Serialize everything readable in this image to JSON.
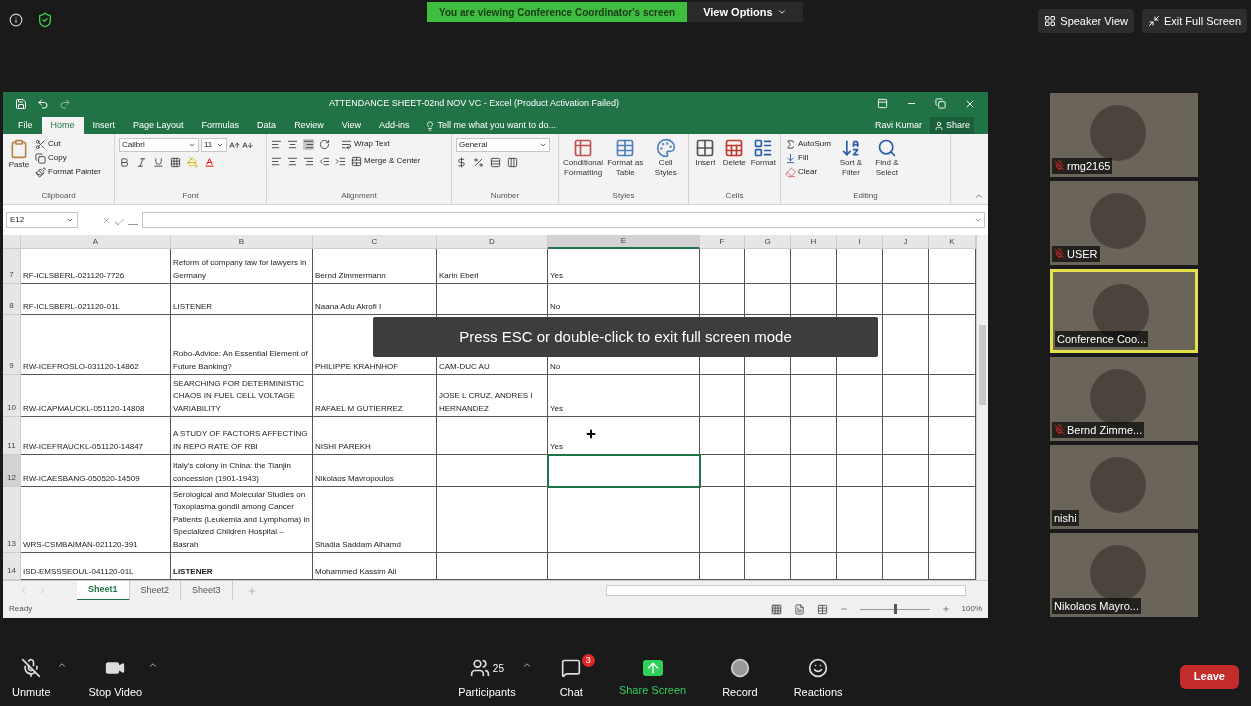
{
  "top_bar": {
    "banner": "You are viewing Conference Coordinator's screen",
    "view_options": "View Options",
    "speaker_view": "Speaker View",
    "exit_full_screen": "Exit Full Screen"
  },
  "excel": {
    "title": "ATTENDANCE SHEET-02nd NOV VC - Excel (Product Activation Failed)",
    "tabs": [
      {
        "label": "File",
        "selected": false
      },
      {
        "label": "Home",
        "selected": true
      },
      {
        "label": "Insert",
        "selected": false
      },
      {
        "label": "Page Layout",
        "selected": false
      },
      {
        "label": "Formulas",
        "selected": false
      },
      {
        "label": "Data",
        "selected": false
      },
      {
        "label": "Review",
        "selected": false
      },
      {
        "label": "View",
        "selected": false
      },
      {
        "label": "Add-ins",
        "selected": false
      }
    ],
    "tell_me": "Tell me what you want to do...",
    "user": "Ravi Kumar",
    "share": "Share",
    "ribbon": {
      "clipboard": {
        "label": "Clipboard",
        "paste": "Paste",
        "cut": "Cut",
        "copy": "Copy",
        "format_painter": "Format Painter"
      },
      "font": {
        "label": "Font",
        "name": "Calibri",
        "size": "11"
      },
      "alignment": {
        "label": "Alignment",
        "wrap_text": "Wrap Text",
        "merge_center": "Merge & Center"
      },
      "number": {
        "label": "Number",
        "format": "General"
      },
      "styles": {
        "label": "Styles",
        "items": [
          "Conditional Formatting",
          "Format as Table",
          "Cell Styles"
        ]
      },
      "cells": {
        "label": "Cells",
        "items": [
          "Insert",
          "Delete",
          "Format"
        ]
      },
      "editing": {
        "label": "Editing",
        "autosum": "AutoSum",
        "fill": "Fill",
        "clear": "Clear",
        "sort_filter": "Sort & Filter",
        "find_select": "Find & Select"
      }
    },
    "name_box": "E12",
    "sheet": {
      "columns": [
        {
          "label": "A",
          "selected": false
        },
        {
          "label": "B",
          "selected": false
        },
        {
          "label": "C",
          "selected": false
        },
        {
          "label": "D",
          "selected": false
        },
        {
          "label": "E",
          "selected": true
        },
        {
          "label": "F",
          "selected": false
        },
        {
          "label": "G",
          "selected": false
        },
        {
          "label": "H",
          "selected": false
        },
        {
          "label": "I",
          "selected": false
        },
        {
          "label": "J",
          "selected": false
        },
        {
          "label": "K",
          "selected": false
        }
      ],
      "rows": [
        {
          "number": "7",
          "selected": false,
          "cells": [
            {
              "text": "RF-ICLSBERL-021120-7726",
              "bold": false
            },
            {
              "text": "Reform of company law for lawyers in Germany",
              "bold": false
            },
            {
              "text": "Bernd Zimmermann",
              "bold": false
            },
            {
              "text": "Karin Eberl",
              "bold": false
            },
            {
              "text": "Yes",
              "bold": false
            }
          ]
        },
        {
          "number": "8",
          "selected": false,
          "cells": [
            {
              "text": "RF-ICLSBERL-021120-01L",
              "bold": false
            },
            {
              "text": "LISTENER",
              "bold": false
            },
            {
              "text": "Naana Adu Akrofi I",
              "bold": false
            },
            null,
            {
              "text": "No",
              "bold": false
            }
          ]
        },
        {
          "number": "9",
          "selected": false,
          "cells": [
            {
              "text": "RW-ICEFROSLO-031120-14862",
              "bold": false
            },
            {
              "text": "Robo-Advice: An Essential Element of Future Banking?",
              "bold": false
            },
            {
              "text": "PHILIPPE KRAHNHOF",
              "bold": false
            },
            {
              "text": "CAM-DUC AU",
              "bold": false
            },
            {
              "text": "No",
              "bold": false
            }
          ]
        },
        {
          "number": "10",
          "selected": false,
          "cells": [
            {
              "text": "RW-ICAPMAUCKL-051120-14808",
              "bold": false
            },
            {
              "text": "SEARCHING FOR DETERMINISTIC CHAOS IN FUEL CELL VOLTAGE VARIABILITY",
              "bold": false
            },
            {
              "text": "RAFAEL M GUTIERREZ",
              "bold": false
            },
            {
              "text": "JOSE L CRUZ, ANDRES I HERNANDEZ",
              "bold": false
            },
            {
              "text": "Yes",
              "bold": false
            }
          ]
        },
        {
          "number": "11",
          "selected": false,
          "cells": [
            {
              "text": "RW-ICEFRAUCKL-051120-14847",
              "bold": false
            },
            {
              "text": "A STUDY OF FACTORS AFFECTING IN REPO RATE OF RBI",
              "bold": false
            },
            {
              "text": "NISHI PAREKH",
              "bold": false
            },
            null,
            {
              "text": "Yes",
              "bold": false
            }
          ]
        },
        {
          "number": "12",
          "selected": true,
          "cells": [
            {
              "text": "RW-ICAESBANG-050520-14509",
              "bold": false
            },
            {
              "text": "Italy's colony in China: the Tianjin concession (1901-1943)",
              "bold": false
            },
            {
              "text": "Nikolaos Mavropoulos",
              "bold": false
            },
            null,
            null
          ]
        },
        {
          "number": "13",
          "selected": false,
          "cells": [
            {
              "text": "WRS-CSMBAIMAN-021120-391",
              "bold": false
            },
            {
              "text": "Serological and Molecular Studies on Toxoplasma gondii among Cancer Patients (Leukemia and Lymphoma) in Specialized Children Hospital – Basrah",
              "bold": false
            },
            {
              "text": "Shadia Saddam Alhamd",
              "bold": false
            },
            null,
            null
          ]
        },
        {
          "number": "14",
          "selected": false,
          "cells": [
            {
              "text": "ISD-EMSSSEOUL-041120-01L",
              "bold": false
            },
            {
              "text": "LISTENER",
              "bold": true
            },
            {
              "text": "Mohammed Kassim Ali",
              "bold": false
            },
            null,
            null
          ]
        }
      ]
    },
    "sheet_tabs": [
      {
        "label": "Sheet1",
        "selected": true
      },
      {
        "label": "Sheet2",
        "selected": false
      },
      {
        "label": "Sheet3",
        "selected": false
      }
    ],
    "status": "Ready",
    "zoom": {
      "level": 0.5,
      "reading": "100%"
    }
  },
  "overlay": "Press ESC or double-click to exit full screen mode",
  "participants": [
    {
      "name": "rmg2165",
      "muted": true,
      "active": false
    },
    {
      "name": "USER",
      "muted": true,
      "active": false
    },
    {
      "name": "Conference Coo...",
      "muted": false,
      "active": true
    },
    {
      "name": "Bernd Zimme...",
      "muted": true,
      "active": false
    },
    {
      "name": "nishi",
      "muted": false,
      "active": false
    },
    {
      "name": "Nikolaos Mayro...",
      "muted": false,
      "active": false
    }
  ],
  "toolbar": [
    {
      "kind": "mic",
      "label": "Unmute",
      "caret": true
    },
    {
      "kind": "video",
      "label": "Stop Video",
      "caret": true
    },
    {
      "kind": "participants",
      "label": "Participants",
      "count": "25",
      "caret": true
    },
    {
      "kind": "chat",
      "label": "Chat",
      "badge": "3",
      "caret": false
    },
    {
      "kind": "share",
      "label": "Share Screen",
      "caret": false
    },
    {
      "kind": "record",
      "label": "Record",
      "caret": false
    },
    {
      "kind": "reactions",
      "label": "Reactions",
      "caret": false
    }
  ],
  "leave": "Leave"
}
